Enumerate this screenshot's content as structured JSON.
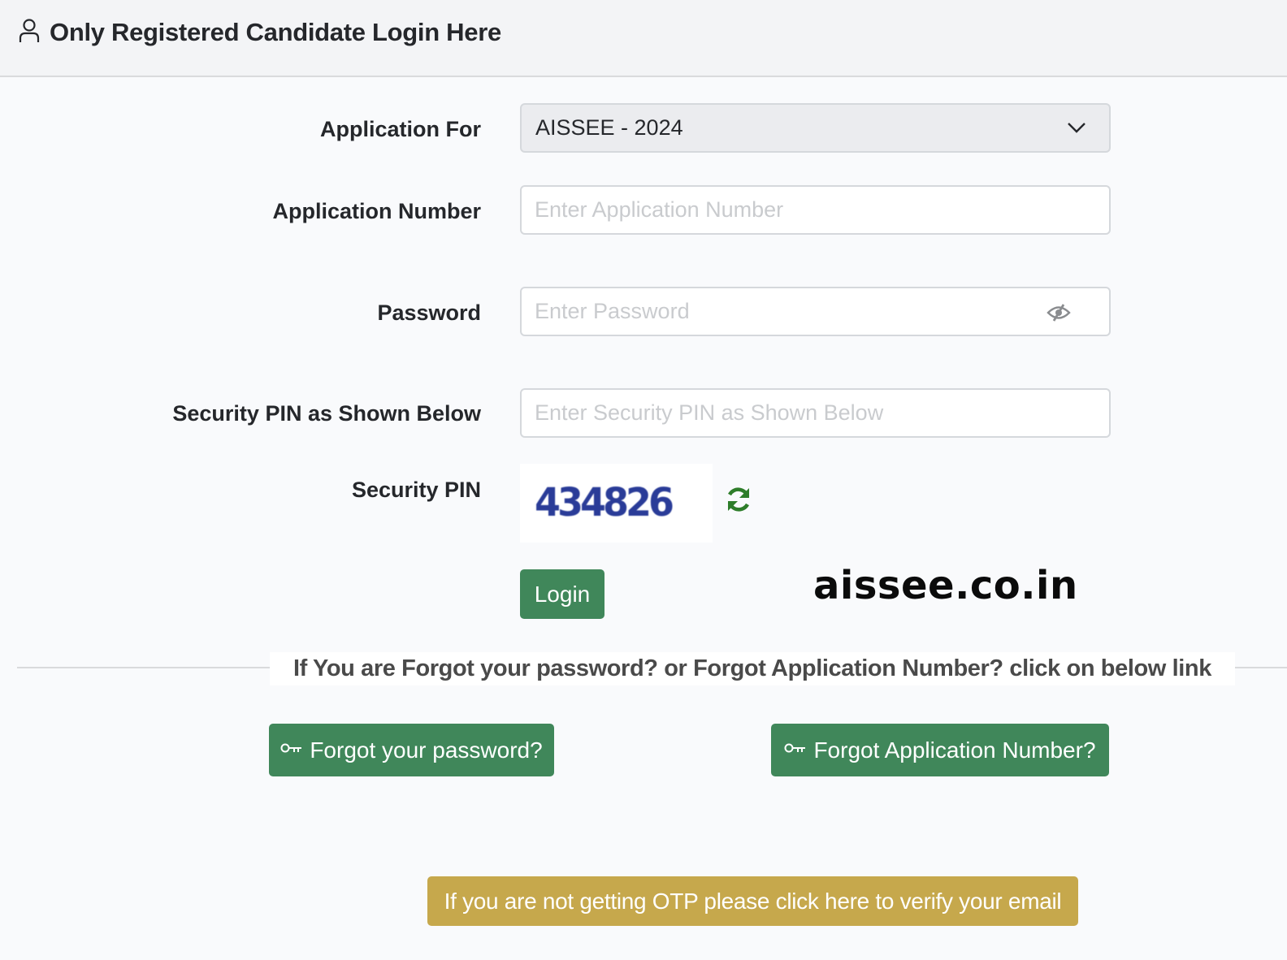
{
  "header": {
    "icon": "user-icon",
    "title": "Only Registered Candidate Login Here"
  },
  "form": {
    "application_for": {
      "label": "Application For",
      "selected": "AISSEE - 2024"
    },
    "application_number": {
      "label": "Application Number",
      "value": "",
      "placeholder": "Enter Application Number"
    },
    "password": {
      "label": "Password",
      "value": "",
      "placeholder": "Enter Password",
      "toggle_icon": "eye-slash-icon"
    },
    "security_pin_input": {
      "label": "Security PIN as Shown Below",
      "value": "",
      "placeholder": "Enter Security PIN as Shown Below"
    },
    "security_pin": {
      "label": "Security PIN",
      "captcha": "434826",
      "refresh_icon": "refresh-icon"
    },
    "login_label": "Login"
  },
  "watermark": "aissee.co.in",
  "forgot": {
    "divider_text": "If You are Forgot your password? or Forgot Application Number? click on below link",
    "password_label": "Forgot your password?",
    "application_label": "Forgot Application Number?",
    "icon": "key-icon"
  },
  "otp_label": "If you are not getting OTP please click here to verify your email",
  "colors": {
    "primary_green": "#40875a",
    "otp_gold": "#c6a84c",
    "captcha_blue": "#2a3c98",
    "refresh_green": "#2e7d2a"
  }
}
